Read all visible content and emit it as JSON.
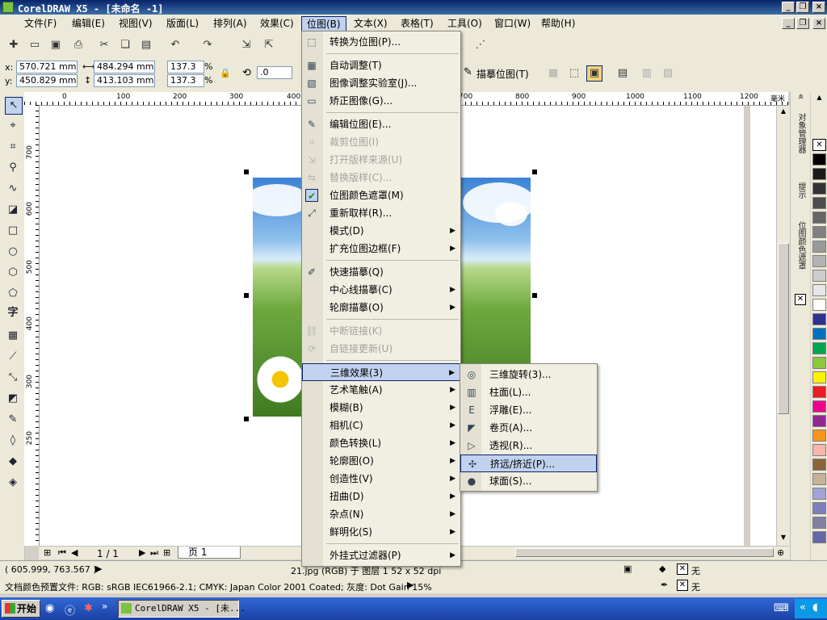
{
  "window": {
    "title": "CorelDRAW X5 - [未命名 -1]"
  },
  "menubar": [
    {
      "label": "文件(F)"
    },
    {
      "label": "编辑(E)"
    },
    {
      "label": "视图(V)"
    },
    {
      "label": "版面(L)"
    },
    {
      "label": "排列(A)"
    },
    {
      "label": "效果(C)"
    },
    {
      "label": "位图(B)"
    },
    {
      "label": "文本(X)"
    },
    {
      "label": "表格(T)"
    },
    {
      "label": "工具(O)"
    },
    {
      "label": "窗口(W)"
    },
    {
      "label": "帮助(H)"
    }
  ],
  "propbar": {
    "x_label": "x:",
    "x_value": "570.721 mm",
    "y_label": "y:",
    "y_value": "450.829 mm",
    "w_value": "484.294 mm",
    "h_value": "413.103 mm",
    "scale_x": "137.3",
    "scale_y": "137.3",
    "pct": "%",
    "rotation": ".0",
    "trace_label": "描摹位图(T)"
  },
  "rulers": {
    "unit": "毫米",
    "h_ticks": [
      "0",
      "100",
      "200",
      "300",
      "400",
      "700",
      "800",
      "900",
      "1000",
      "1100",
      "1200"
    ],
    "v_ticks": [
      "700",
      "650",
      "600",
      "550",
      "500",
      "450",
      "400",
      "350",
      "300",
      "250"
    ]
  },
  "bitmap_menu": {
    "items": [
      {
        "label": "转换为位图(P)...",
        "icon": "convert-bitmap-icon"
      },
      {
        "sep": true
      },
      {
        "label": "自动调整(T)",
        "icon": "auto-adjust-icon"
      },
      {
        "label": "图像调整实验室(J)...",
        "icon": "image-lab-icon"
      },
      {
        "label": "矫正图像(G)...",
        "icon": "straighten-icon"
      },
      {
        "sep": true
      },
      {
        "label": "编辑位图(E)...",
        "icon": "edit-bitmap-icon"
      },
      {
        "label": "裁剪位图(I)",
        "icon": "crop-bitmap-icon",
        "disabled": true
      },
      {
        "label": "打开版样来源(U)",
        "icon": "open-source-icon",
        "disabled": true
      },
      {
        "label": "替换版样(C)...",
        "icon": "replace-icon",
        "disabled": true
      },
      {
        "label": "位图颜色遮罩(M)",
        "icon": "check-icon"
      },
      {
        "label": "重新取样(R)...",
        "icon": "resample-icon"
      },
      {
        "label": "模式(D)",
        "submenu": true
      },
      {
        "label": "扩充位图边框(F)",
        "submenu": true
      },
      {
        "sep": true
      },
      {
        "label": "快速描摹(Q)",
        "icon": "quick-trace-icon"
      },
      {
        "label": "中心线描摹(C)",
        "submenu": true
      },
      {
        "label": "轮廓描摹(O)",
        "submenu": true
      },
      {
        "sep": true
      },
      {
        "label": "中断链接(K)",
        "icon": "break-link-icon",
        "disabled": true
      },
      {
        "label": "自链接更新(U)",
        "icon": "update-link-icon",
        "disabled": true
      },
      {
        "sep": true
      },
      {
        "label": "三维效果(3)",
        "submenu": true,
        "highlighted": true
      },
      {
        "label": "艺术笔触(A)",
        "submenu": true
      },
      {
        "label": "模糊(B)",
        "submenu": true
      },
      {
        "label": "相机(C)",
        "submenu": true
      },
      {
        "label": "颜色转换(L)",
        "submenu": true
      },
      {
        "label": "轮廓图(O)",
        "submenu": true
      },
      {
        "label": "创造性(V)",
        "submenu": true
      },
      {
        "label": "扭曲(D)",
        "submenu": true
      },
      {
        "label": "杂点(N)",
        "submenu": true
      },
      {
        "label": "鲜明化(S)",
        "submenu": true
      },
      {
        "sep": true
      },
      {
        "label": "外挂式过滤器(P)",
        "submenu": true
      }
    ]
  },
  "effects_submenu": {
    "items": [
      {
        "label": "三维旋转(3)...",
        "icon": "3d-rotate-icon"
      },
      {
        "label": "柱面(L)...",
        "icon": "cylinder-icon"
      },
      {
        "label": "浮雕(E)...",
        "icon": "emboss-icon"
      },
      {
        "label": "卷页(A)...",
        "icon": "page-curl-icon"
      },
      {
        "label": "透视(R)...",
        "icon": "perspective-icon"
      },
      {
        "label": "挤远/挤近(P)...",
        "icon": "pinch-punch-icon",
        "highlighted": true
      },
      {
        "label": "球面(S)...",
        "icon": "sphere-icon"
      }
    ]
  },
  "dockers": {
    "tab1": "对象管理器",
    "tab2": "提示",
    "tab3": "位图颜色遮罩"
  },
  "page_nav": {
    "counter": "1 / 1",
    "tab": "页 1"
  },
  "status": {
    "coords": "( 605.999, 763.567 )",
    "object_info": "21.jpg (RGB) 于 图层 1 52 x 52 dpi",
    "fill_label": "无",
    "outline_label": "无",
    "color_profile": "文档颜色预置文件: RGB: sRGB IEC61966-2.1; CMYK: Japan Color 2001 Coated; 灰度: Dot Gain 15%"
  },
  "taskbar": {
    "start": "开始",
    "task": "CorelDRAW X5 - [未..."
  },
  "palette_colors": [
    "#ffffff",
    "#000000",
    "#1a1a1a",
    "#333333",
    "#4d4d4d",
    "#666666",
    "#808080",
    "#999999",
    "#b3b3b3",
    "#cccccc",
    "#e6e6e6",
    "#ffffff",
    "#2e3192",
    "#0072bc",
    "#00a651",
    "#8dc63f",
    "#fff200",
    "#ed1c24",
    "#ec008c",
    "#92278f",
    "#f7941d",
    "#f9b4ab",
    "#8c6239",
    "#c7b299",
    "#a3a3d9",
    "#7f7fbf",
    "#8080a0",
    "#6666aa"
  ]
}
